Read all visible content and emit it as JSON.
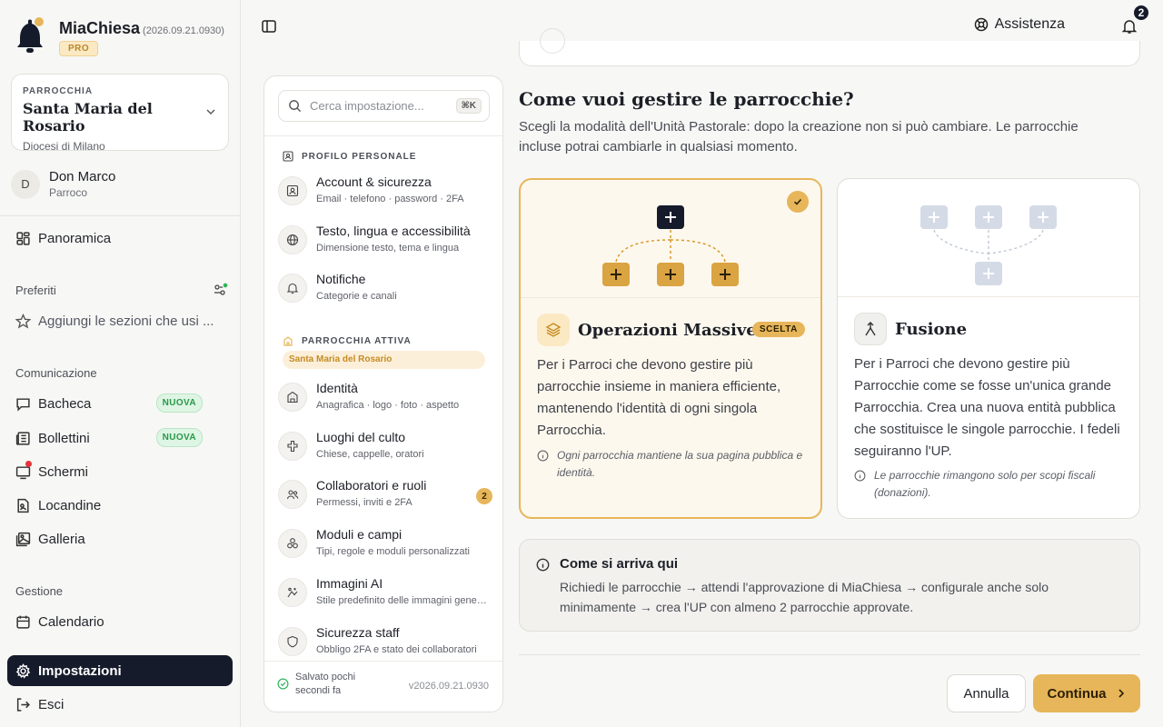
{
  "brand": {
    "name": "MiaChiesa",
    "version": "(2026.09.21.0930)",
    "badge": "PRO"
  },
  "parish": {
    "label": "PARROCCHIA",
    "name": "Santa Maria del Rosario",
    "diocese": "Diocesi di Milano"
  },
  "user": {
    "initial": "D",
    "name": "Don Marco",
    "role": "Parroco"
  },
  "nav": {
    "overview": "Panoramica",
    "favorites_label": "Preferiti",
    "favorites_hint": "Aggiungi le sezioni che usi ...",
    "communication_label": "Comunicazione",
    "communication": [
      {
        "label": "Bacheca",
        "badge": "NUOVA"
      },
      {
        "label": "Bollettini",
        "badge": "NUOVA"
      },
      {
        "label": "Schermi"
      },
      {
        "label": "Locandine"
      },
      {
        "label": "Galleria"
      }
    ],
    "management_label": "Gestione",
    "calendar": "Calendario",
    "settings": "Impostazioni",
    "logout": "Esci"
  },
  "topbar": {
    "help": "Assistenza",
    "notifications": "2"
  },
  "settings_panel": {
    "search_placeholder": "Cerca impostazione...",
    "search_shortcut": "⌘K",
    "section_personal": "PROFILO PERSONALE",
    "personal_items": [
      {
        "title": "Account & sicurezza",
        "desc": "Email · telefono · password · 2FA"
      },
      {
        "title": "Testo, lingua e accessibilità",
        "desc": "Dimensione testo, tema e lingua"
      },
      {
        "title": "Notifiche",
        "desc": "Categorie e canali"
      }
    ],
    "section_parish": "PARROCCHIA ATTIVA",
    "active_parish": "Santa Maria del Rosario",
    "parish_items": [
      {
        "title": "Identità",
        "desc": "Anagrafica · logo · foto · aspetto"
      },
      {
        "title": "Luoghi del culto",
        "desc": "Chiese, cappelle, oratori"
      },
      {
        "title": "Collaboratori e ruoli",
        "desc": "Permessi, inviti e 2FA",
        "count": "2"
      },
      {
        "title": "Moduli e campi",
        "desc": "Tipi, regole e moduli personalizzati"
      },
      {
        "title": "Immagini AI",
        "desc": "Stile predefinito delle immagini generate"
      },
      {
        "title": "Sicurezza staff",
        "desc": "Obbligo 2FA e stato dei collaboratori"
      }
    ],
    "saved_line1": "Salvato pochi",
    "saved_line2": "secondi fa",
    "version": "v2026.09.21.0930"
  },
  "main": {
    "title": "Come vuoi gestire le parrocchie?",
    "subtitle": "Scegli la modalità dell'Unità Pastorale: dopo la creazione non si può cambiare. Le parrocchie incluse potrai cambiarle in qualsiasi momento.",
    "options": [
      {
        "name": "Operazioni Massive",
        "chosen_label": "SCELTA",
        "desc": "Per i Parroci che devono gestire più parrocchie insieme in maniera efficiente, mantenendo l'identità di ogni singola Parrocchia.",
        "note": "Ogni parrocchia mantiene la sua pagina pubblica e identità.",
        "selected": true
      },
      {
        "name": "Fusione",
        "desc": "Per i Parroci che devono gestire più Parrocchie come se fosse un'unica grande Parrocchia. Crea una nuova entità pubblica che sostituisce le singole parrocchie. I fedeli seguiranno l'UP.",
        "note": "Le parrocchie rimangono solo per scopi fiscali (donazioni).",
        "selected": false
      }
    ],
    "how_title": "Come si arriva qui",
    "how_text": "Richiedi le parrocchie → attendi l'approvazione di MiaChiesa → configurale anche solo minimamente → crea l'UP con almeno 2 parrocchie approvate."
  },
  "actions": {
    "cancel": "Annulla",
    "continue": "Continua"
  },
  "colors": {
    "accent": "#e7b65a",
    "dark": "#161b2b",
    "success": "#279a48",
    "alert": "#e5333a"
  }
}
